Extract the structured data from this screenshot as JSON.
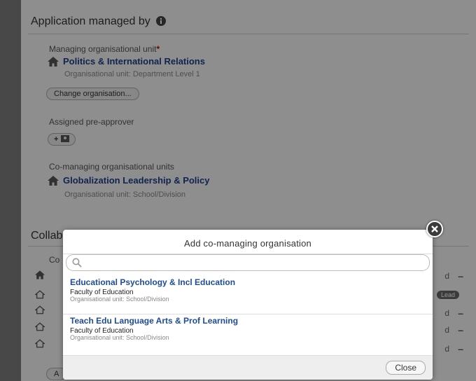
{
  "section1": {
    "title": "Application managed by",
    "managing_label": "Managing organisational unit",
    "required_mark": "*",
    "managing_org": "Politics & International Relations",
    "managing_org_unit": "Organisational unit: Department Level 1",
    "change_button": "Change organisation...",
    "preapprover_label": "Assigned pre-approver",
    "preapprover_button": "+",
    "comanaging_label": "Co-managing organisational units",
    "comanaging_org": "Globalization Leadership & Policy",
    "comanaging_org_unit": "Organisational unit: School/Division"
  },
  "section2": {
    "title": "Collab",
    "sub_label": "Co",
    "rows_side": [
      "d",
      "",
      "d",
      "d",
      "d"
    ],
    "lead_badge": "Lead",
    "add_button": "A"
  },
  "modal": {
    "title": "Add co-managing organisation",
    "search_placeholder": "",
    "results": [
      {
        "name": "Educational Psychology & Incl Education",
        "faculty": "Faculty of Education",
        "unit": "Organisational unit: School/Division"
      },
      {
        "name": "Teach Edu Language Arts & Prof Learning",
        "faculty": "Faculty of Education",
        "unit": "Organisational unit: School/Division"
      }
    ],
    "close_label": "Close"
  },
  "colors": {
    "link": "#1d3f8a",
    "required": "#cc0000",
    "overlay": "#000000"
  }
}
